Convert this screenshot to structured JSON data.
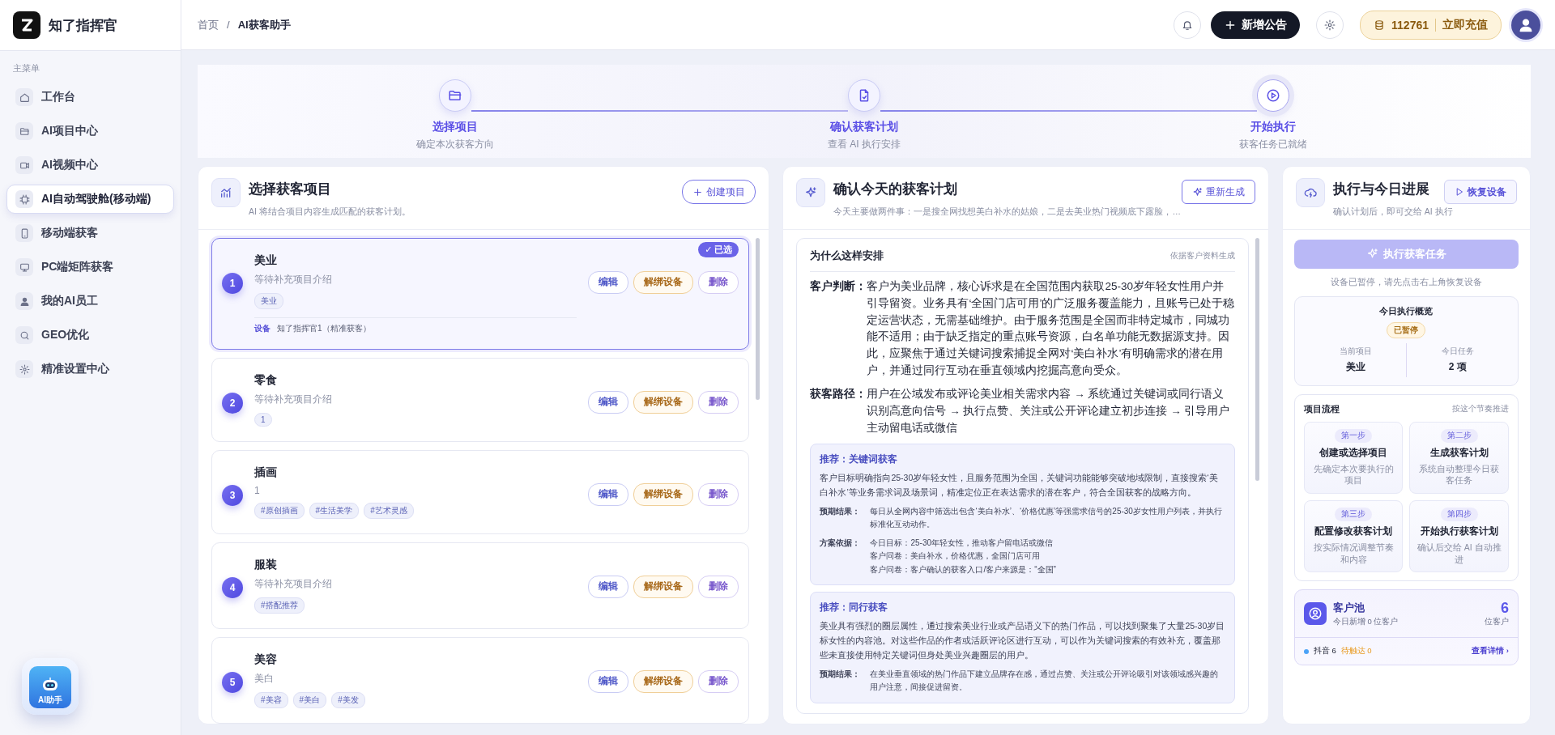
{
  "brand": {
    "name": "知了指挥官"
  },
  "breadcrumb": {
    "items": [
      "首页",
      "AI获客助手"
    ],
    "separator": "/"
  },
  "header": {
    "new_button": "新增公告",
    "credits": "112761",
    "recharge": "立即充值"
  },
  "sidebar": {
    "section_label": "主菜单",
    "items": [
      {
        "label": "工作台",
        "selected": false
      },
      {
        "label": "AI项目中心",
        "selected": false
      },
      {
        "label": "AI视频中心",
        "selected": false
      },
      {
        "label": "AI自动驾驶舱(移动端)",
        "selected": true
      },
      {
        "label": "移动端获客",
        "selected": false
      },
      {
        "label": "PC端矩阵获客",
        "selected": false
      },
      {
        "label": "我的AI员工",
        "selected": false
      },
      {
        "label": "GEO优化",
        "selected": false
      },
      {
        "label": "精准设置中心",
        "selected": false
      }
    ],
    "assistant": "AI助手"
  },
  "steps": [
    {
      "title": "选择项目",
      "subtitle": "确定本次获客方向"
    },
    {
      "title": "确认获客计划",
      "subtitle": "查看 AI 执行安排"
    },
    {
      "title": "开始执行",
      "subtitle": "获客任务已就绪"
    }
  ],
  "projects": {
    "title": "选择获客项目",
    "subtitle": "AI 将结合项目内容生成匹配的获客计划。",
    "create_button": "创建项目",
    "items": [
      {
        "number": "1",
        "name": "美业",
        "description": "等待补充项目介绍",
        "tags": [
          "美业"
        ],
        "device": {
          "label": "设备",
          "value": "知了指挥官1（精准获客）"
        },
        "selected": true,
        "badge": "✓ 已选",
        "actions": [
          {
            "kind": "edit",
            "label": "编辑"
          },
          {
            "kind": "unbind",
            "label": "解绑设备"
          },
          {
            "kind": "delete",
            "label": "删除"
          }
        ]
      },
      {
        "number": "2",
        "name": "零食",
        "description": "等待补充项目介绍",
        "tags": [
          "1"
        ],
        "selected": false,
        "actions": [
          {
            "kind": "edit",
            "label": "编辑"
          },
          {
            "kind": "unbind",
            "label": "解绑设备"
          },
          {
            "kind": "delete",
            "label": "删除"
          }
        ]
      },
      {
        "number": "3",
        "name": "插画",
        "description": "1",
        "tags": [
          "#原创插画",
          "#生活美学",
          "#艺术灵感"
        ],
        "selected": false,
        "actions": [
          {
            "kind": "edit",
            "label": "编辑"
          },
          {
            "kind": "unbind",
            "label": "解绑设备"
          },
          {
            "kind": "delete",
            "label": "删除"
          }
        ]
      },
      {
        "number": "4",
        "name": "服装",
        "description": "等待补充项目介绍",
        "tags": [
          "#搭配推荐"
        ],
        "selected": false,
        "actions": [
          {
            "kind": "edit",
            "label": "编辑"
          },
          {
            "kind": "unbind",
            "label": "解绑设备"
          },
          {
            "kind": "delete",
            "label": "删除"
          }
        ]
      },
      {
        "number": "5",
        "name": "美容",
        "description": "美白",
        "tags": [
          "#美容",
          "#美白",
          "#美发"
        ],
        "selected": false,
        "actions": [
          {
            "kind": "edit",
            "label": "编辑"
          },
          {
            "kind": "unbind",
            "label": "解绑设备"
          },
          {
            "kind": "delete",
            "label": "删除"
          }
        ]
      }
    ]
  },
  "plan": {
    "title": "确认今天的获客计划",
    "subtitle": "今天主要做两件事：一是搜全网找想美白补水的姑娘，二是去美业热门视频底下露脸，…",
    "regenerate_button": "重新生成",
    "reason": {
      "title": "为什么这样安排",
      "note": "依据客户资料生成",
      "items": [
        {
          "label": "客户判断：",
          "text": "客户为美业品牌，核心诉求是在全国范围内获取25-30岁年轻女性用户并引导留资。业务具有‘全国门店可用’的广泛服务覆盖能力，且账号已处于稳定运营状态，无需基础维护。由于服务范围是全国而非特定城市，同城功能不适用；由于缺乏指定的重点账号资源，白名单功能无数据源支持。因此，应聚焦于通过关键词搜索捕捉全网对‘美白补水’有明确需求的潜在用户，并通过同行互动在垂直领域内挖掘高意向受众。"
        },
        {
          "label": "获客路径：",
          "text": "用户在公域发布或评论美业相关需求内容 → 系统通过关键词或同行语义识别高意向信号 → 执行点赞、关注或公开评论建立初步连接 → 引导用户主动留电话或微信"
        }
      ]
    },
    "recommendations": [
      {
        "title": "推荐：关键词获客",
        "description": "客户目标明确指向25-30岁年轻女性，且服务范围为全国，关键词功能能够突破地域限制，直接搜索‘美白补水’等业务需求词及场景词，精准定位正在表达需求的潜在客户，符合全国获客的战略方向。",
        "details": [
          {
            "label": "预期结果：",
            "lines": [
              "每日从全网内容中筛选出包含‘美白补水’、‘价格优惠’等强需求信号的25-30岁女性用户列表，并执行标准化互动动作。"
            ]
          },
          {
            "label": "方案依据：",
            "lines": [
              "今日目标：25-30年轻女性，推动客户留电话或微信",
              "客户问卷：美白补水，价格优惠，全国门店可用",
              "客户问卷：客户确认的获客入口/客户来源是：“全国”"
            ]
          }
        ]
      },
      {
        "title": "推荐：同行获客",
        "description": "美业具有强烈的圈层属性，通过搜索美业行业或产品语义下的热门作品，可以找到聚集了大量25-30岁目标女性的内容池。对这些作品的作者或活跃评论区进行互动，可以作为关键词搜索的有效补充，覆盖那些未直接使用特定关键词但身处美业兴趣圈层的用户。",
        "details": [
          {
            "label": "预期结果：",
            "lines": [
              "在美业垂直领域的热门作品下建立品牌存在感，通过点赞、关注或公开评论吸引对该领域感兴趣的用户注意，间接促进留资。"
            ]
          }
        ]
      }
    ]
  },
  "execution": {
    "title": "执行与今日进展",
    "subtitle": "确认计划后，即可交给 AI 执行",
    "resume_button": "恢复设备",
    "execute_button": {
      "label": "执行获客任务",
      "disabled": true
    },
    "hint": "设备已暂停，请先点击右上角恢复设备",
    "overview": {
      "title": "今日执行概览",
      "status": "已暂停",
      "stats": [
        {
          "label": "当前项目",
          "value": "美业"
        },
        {
          "label": "今日任务",
          "value": "2 项"
        }
      ]
    },
    "flow": {
      "title": "项目流程",
      "note": "按这个节奏推进",
      "steps": [
        {
          "badge": "第一步",
          "title": "创建或选择项目",
          "description": "先确定本次要执行的项目"
        },
        {
          "badge": "第二步",
          "title": "生成获客计划",
          "description": "系统自动整理今日获客任务"
        },
        {
          "badge": "第三步",
          "title": "配置修改获客计划",
          "description": "按实际情况调整节奏和内容"
        },
        {
          "badge": "第四步",
          "title": "开始执行获客计划",
          "description": "确认后交给 AI 自动推进"
        }
      ]
    },
    "pool": {
      "title": "客户池",
      "subtitle": "今日新增 0 位客户",
      "count": "6",
      "unit": "位客户",
      "sources": [
        {
          "label": "抖音 6",
          "color": "#4ba3f7"
        }
      ],
      "pending": "待触达 0",
      "link": "查看详情 ›"
    }
  }
}
